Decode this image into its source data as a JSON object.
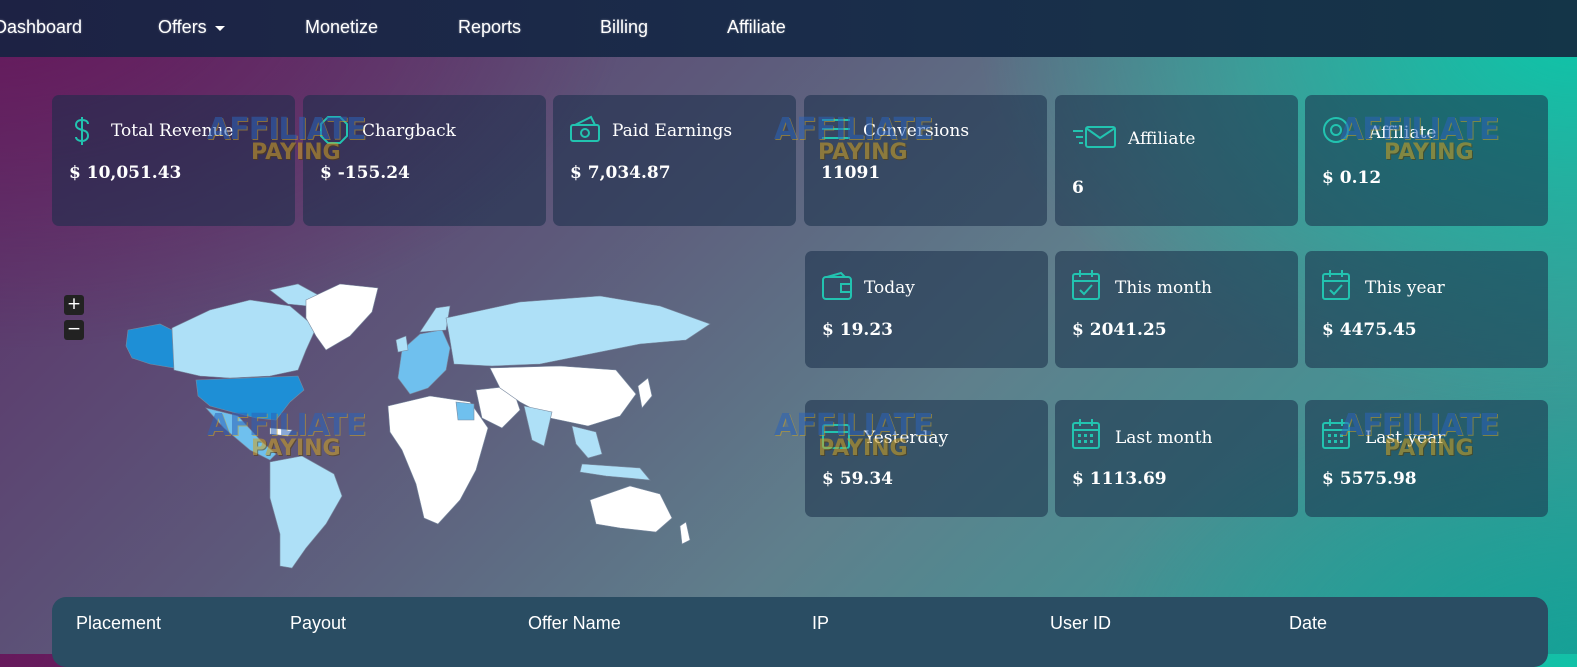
{
  "nav": {
    "items": [
      {
        "label": "Dashboard"
      },
      {
        "label": "Offers"
      },
      {
        "label": "Monetize"
      },
      {
        "label": "Reports"
      },
      {
        "label": "Billing"
      },
      {
        "label": "Affiliate"
      }
    ]
  },
  "stats": [
    {
      "label": "Total Revenue",
      "value": "$ 10,051.43",
      "icon": "dollar-icon"
    },
    {
      "label": "Chargback",
      "value": "$ -155.24",
      "icon": "octagon-icon"
    },
    {
      "label": "Paid Earnings",
      "value": "$ 7,034.87",
      "icon": "cash-icon"
    },
    {
      "label": "Conversions",
      "value": "11091",
      "icon": "list-icon"
    },
    {
      "label": "Affiliate",
      "value": "6",
      "icon": "mail-icon"
    },
    {
      "label": "Affiliate",
      "value": "$ 0.12",
      "icon": "target-icon"
    }
  ],
  "earnings": [
    {
      "label": "Today",
      "value": "$ 19.23",
      "icon": "wallet-icon"
    },
    {
      "label": "This month",
      "value": "$ 2041.25",
      "icon": "calendar-check-icon"
    },
    {
      "label": "This year",
      "value": "$ 4475.45",
      "icon": "calendar-check-icon"
    },
    {
      "label": "Yesterday",
      "value": "$ 59.34",
      "icon": "calendar-icon"
    },
    {
      "label": "Last month",
      "value": "$ 1113.69",
      "icon": "calendar-grid-icon"
    },
    {
      "label": "Last year",
      "value": "$ 5575.98",
      "icon": "calendar-grid-icon"
    }
  ],
  "map": {
    "zoom_in": "+",
    "zoom_out": "−"
  },
  "watermark": {
    "line1": "AFFILIATE",
    "line2": "PAYING"
  },
  "table": {
    "columns": [
      "Placement",
      "Payout",
      "Offer Name",
      "IP",
      "User ID",
      "Date"
    ]
  },
  "colors": {
    "accent": "#22c3b0",
    "map_ocean": "transparent",
    "map_land": "#ffffff",
    "map_light": "#aee0f7",
    "map_mid": "#6fc0ee",
    "map_dark": "#1e8fd6"
  }
}
